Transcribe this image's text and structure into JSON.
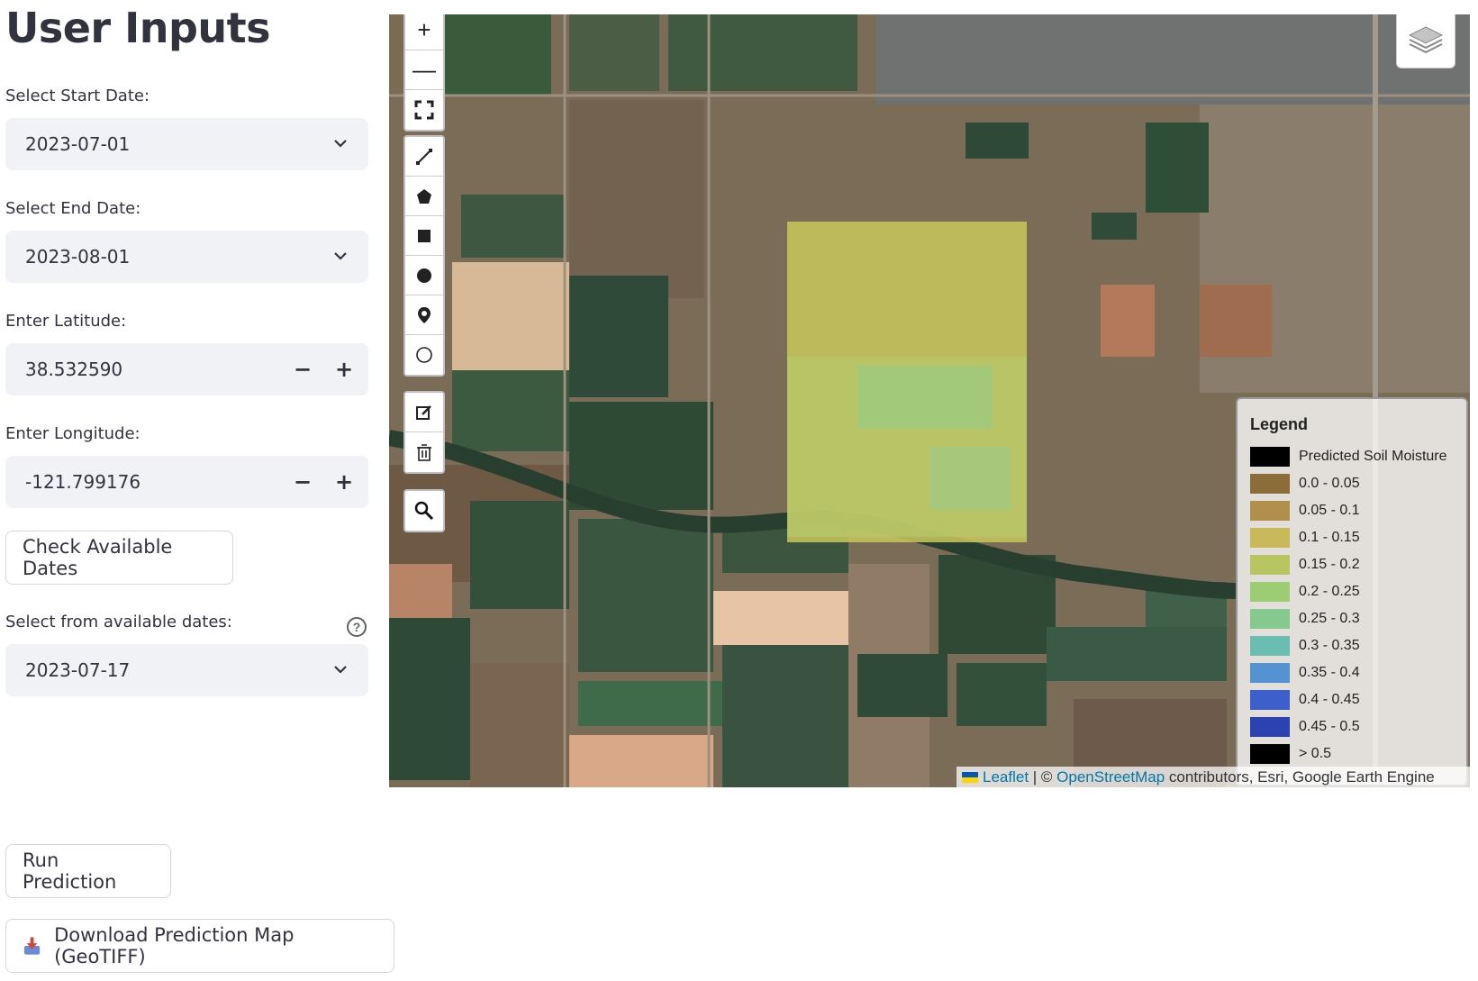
{
  "sidebar": {
    "title": "User Inputs",
    "start_date": {
      "label": "Select Start Date:",
      "value": "2023-07-01"
    },
    "end_date": {
      "label": "Select End Date:",
      "value": "2023-08-01"
    },
    "latitude": {
      "label": "Enter Latitude:",
      "value": "38.532590",
      "minus": "−",
      "plus": "+"
    },
    "longitude": {
      "label": "Enter Longitude:",
      "value": "-121.799176",
      "minus": "−",
      "plus": "+"
    },
    "check_button": "Check Available Dates",
    "available": {
      "label": "Select from available dates:",
      "help": "?",
      "value": "2023-07-17"
    },
    "run_button": "Run Prediction",
    "download_button": "Download Prediction Map (GeoTIFF)"
  },
  "map": {
    "controls": {
      "zoom_in": "+",
      "zoom_out": "—"
    },
    "legend": {
      "title": "Legend",
      "items": [
        {
          "label": "Predicted Soil Moisture",
          "color": "#000000"
        },
        {
          "label": "0.0 - 0.05",
          "color": "#8b6d3a"
        },
        {
          "label": "0.05 - 0.1",
          "color": "#b08f4c"
        },
        {
          "label": "0.1 - 0.15",
          "color": "#c9b95a"
        },
        {
          "label": "0.15 - 0.2",
          "color": "#b8c662"
        },
        {
          "label": "0.2 - 0.25",
          "color": "#9ccc73"
        },
        {
          "label": "0.25 - 0.3",
          "color": "#86c98f"
        },
        {
          "label": "0.3 - 0.35",
          "color": "#6bbcb1"
        },
        {
          "label": "0.35 - 0.4",
          "color": "#5592d1"
        },
        {
          "label": "0.4 - 0.45",
          "color": "#3c5fcc"
        },
        {
          "label": "0.45 - 0.5",
          "color": "#2c42b0"
        },
        {
          "label": "> 0.5",
          "color": "#000000"
        }
      ]
    },
    "attribution": {
      "leaflet": "Leaflet",
      "sep": " | © ",
      "osm": "OpenStreetMap",
      "rest": " contributors, Esri, Google Earth Engine"
    }
  }
}
